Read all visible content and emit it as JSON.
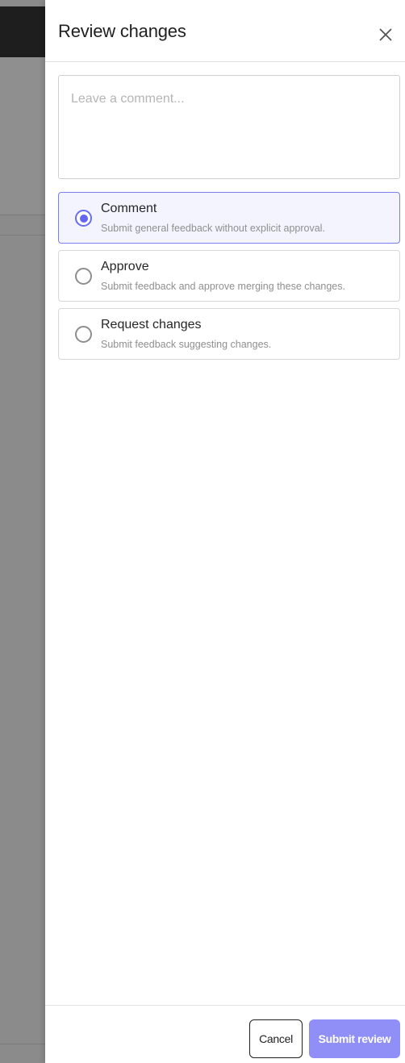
{
  "drawer": {
    "title": "Review changes",
    "close_icon": "close-icon"
  },
  "comment": {
    "value": "",
    "placeholder": "Leave a comment..."
  },
  "options": [
    {
      "title": "Comment",
      "description": "Submit general feedback without explicit approval.",
      "selected": true
    },
    {
      "title": "Approve",
      "description": "Submit feedback and approve merging these changes.",
      "selected": false
    },
    {
      "title": "Request changes",
      "description": "Submit feedback suggesting changes.",
      "selected": false
    }
  ],
  "footer": {
    "cancel_label": "Cancel",
    "submit_label": "Submit review"
  },
  "colors": {
    "accent": "#6466f1",
    "submit_bg": "#8f8ff7",
    "selected_bg": "#f4f4ff"
  }
}
